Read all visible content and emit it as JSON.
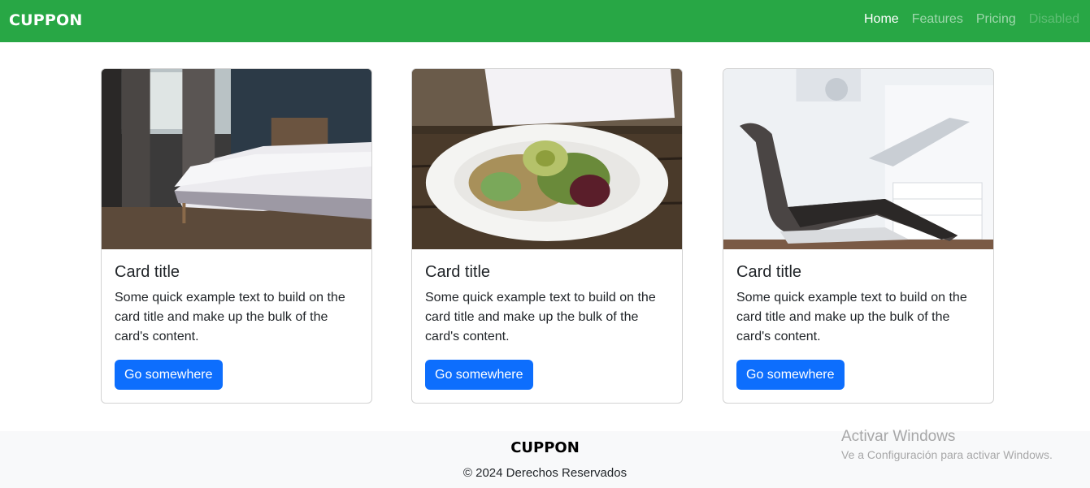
{
  "navbar": {
    "brand": "CUPPON",
    "links": [
      {
        "label": "Home",
        "state": "active"
      },
      {
        "label": "Features",
        "state": "normal"
      },
      {
        "label": "Pricing",
        "state": "normal"
      },
      {
        "label": "Disabled",
        "state": "disabled"
      }
    ]
  },
  "cards": [
    {
      "image": "bedroom-photo",
      "title": "Card title",
      "text": "Some quick example text to build on the card title and make up the bulk of the card's content.",
      "button": "Go somewhere"
    },
    {
      "image": "salad-plate-photo",
      "title": "Card title",
      "text": "Some quick example text to build on the card title and make up the bulk of the card's content.",
      "button": "Go somewhere"
    },
    {
      "image": "dental-chair-photo",
      "title": "Card title",
      "text": "Some quick example text to build on the card title and make up the bulk of the card's content.",
      "button": "Go somewhere"
    }
  ],
  "footer": {
    "brand": "CUPPON",
    "copyright": "© 2024 Derechos Reservados"
  },
  "watermark": {
    "line1": "Activar Windows",
    "line2": "Ve a Configuración para activar Windows."
  },
  "colors": {
    "navbar": "#28a745",
    "button": "#0d6efd",
    "footer_bg": "#f8f9fa"
  }
}
